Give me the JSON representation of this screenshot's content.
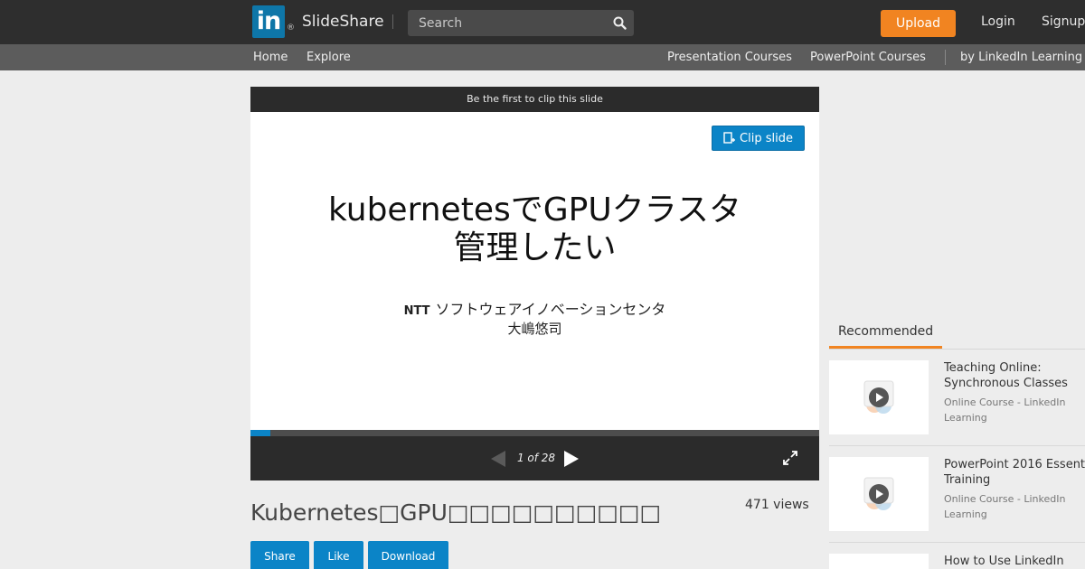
{
  "header": {
    "logo_mark": "in",
    "logo_reg": "®",
    "brand": "SlideShare",
    "search_placeholder": "Search",
    "upload_label": "Upload",
    "login_label": "Login",
    "signup_label": "Signup"
  },
  "subnav": {
    "left": [
      "Home",
      "Explore"
    ],
    "right": [
      "Presentation Courses",
      "PowerPoint Courses",
      "by LinkedIn Learning"
    ]
  },
  "player": {
    "clip_banner": "Be the first to clip this slide",
    "clip_button": "Clip slide",
    "slide_title_line1": "kubernetesでGPUクラスタ",
    "slide_title_line2": "管理したい",
    "slide_org_prefix": "NTT",
    "slide_org": "ソフトウェアイノベーションセンタ",
    "slide_author": "大嶋悠司",
    "page_indicator": "1 of 28",
    "current_page": 1,
    "total_pages": 28
  },
  "doc": {
    "title": "Kubernetes□GPU□□□□□□□□□□",
    "views": "471 views",
    "share_label": "Share",
    "like_label": "Like",
    "download_label": "Download"
  },
  "sidebar": {
    "tab_label": "Recommended",
    "items": [
      {
        "title_line1": "Teaching Online:",
        "title_line2": "Synchronous Classes",
        "sub_line1": "Online Course - LinkedIn",
        "sub_line2": "Learning"
      },
      {
        "title_line1": "PowerPoint 2016 Essent",
        "title_line2": "Training",
        "sub_line1": "Online Course - LinkedIn",
        "sub_line2": "Learning"
      },
      {
        "title_line1": "How to Use LinkedIn",
        "title_line2": "",
        "sub_line1": "",
        "sub_line2": ""
      }
    ]
  },
  "colors": {
    "header_bg": "#2e2e2e",
    "subnav_bg": "#5c5c5c",
    "accent_orange": "#f18421",
    "accent_blue": "#0b84c7",
    "linkedin_blue": "#0e76a8"
  }
}
